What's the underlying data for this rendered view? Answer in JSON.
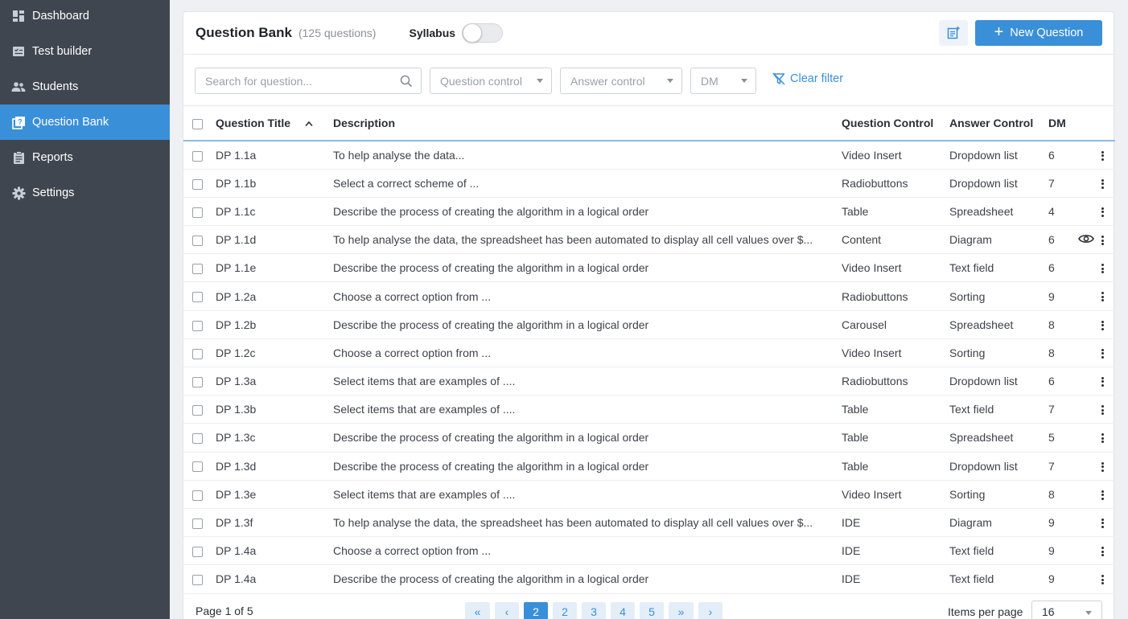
{
  "sidebar": {
    "items": [
      {
        "label": "Dashboard",
        "icon": "dashboard-icon",
        "active": false
      },
      {
        "label": "Test builder",
        "icon": "test-builder-icon",
        "active": false
      },
      {
        "label": "Students",
        "icon": "students-icon",
        "active": false
      },
      {
        "label": "Question Bank",
        "icon": "question-bank-icon",
        "active": true
      },
      {
        "label": "Reports",
        "icon": "reports-icon",
        "active": false
      },
      {
        "label": "Settings",
        "icon": "gear-icon",
        "active": false
      }
    ]
  },
  "header": {
    "title": "Question Bank",
    "count": "(125 questions)",
    "syllabus_label": "Syllabus",
    "syllabus_on": false,
    "new_question_label": "New Question"
  },
  "filters": {
    "search_placeholder": "Search for question...",
    "question_control_placeholder": "Question control",
    "answer_control_placeholder": "Answer control",
    "dm_placeholder": "DM",
    "clear_filter_label": "Clear filter"
  },
  "table": {
    "columns": {
      "title": "Question Title",
      "description": "Description",
      "question_control": "Question Control",
      "answer_control": "Answer Control",
      "dm": "DM"
    },
    "rows": [
      {
        "title": "DP 1.1a",
        "description": "To help analyse the data...",
        "qc": "Video Insert",
        "ac": "Dropdown list",
        "dm": "6",
        "eye": false
      },
      {
        "title": "DP 1.1b",
        "description": "Select a correct scheme of ...",
        "qc": "Radiobuttons",
        "ac": "Dropdown list",
        "dm": "7",
        "eye": false
      },
      {
        "title": "DP 1.1c",
        "description": "Describe the process of creating the algorithm in a logical order",
        "qc": "Table",
        "ac": "Spreadsheet",
        "dm": "4",
        "eye": false
      },
      {
        "title": "DP 1.1d",
        "description": "To help analyse the data, the spreadsheet has been automated to display all cell values over $...",
        "qc": "Content",
        "ac": "Diagram",
        "dm": "6",
        "eye": true
      },
      {
        "title": "DP 1.1e",
        "description": "Describe the process of creating the algorithm in a logical order",
        "qc": "Video Insert",
        "ac": "Text field",
        "dm": "6",
        "eye": false
      },
      {
        "title": "DP 1.2a",
        "description": "Choose a correct option from ...",
        "qc": "Radiobuttons",
        "ac": "Sorting",
        "dm": "9",
        "eye": false
      },
      {
        "title": "DP 1.2b",
        "description": "Describe the process of creating the algorithm in a logical order",
        "qc": "Carousel",
        "ac": "Spreadsheet",
        "dm": "8",
        "eye": false
      },
      {
        "title": "DP 1.2c",
        "description": "Choose a correct option from ...",
        "qc": "Video Insert",
        "ac": "Sorting",
        "dm": "8",
        "eye": false
      },
      {
        "title": "DP 1.3a",
        "description": "Select items that are examples of ....",
        "qc": "Radiobuttons",
        "ac": "Dropdown list",
        "dm": "6",
        "eye": false
      },
      {
        "title": "DP 1.3b",
        "description": "Select items that are examples of ....",
        "qc": "Table",
        "ac": "Text field",
        "dm": "7",
        "eye": false
      },
      {
        "title": "DP 1.3c",
        "description": "Describe the process of creating the algorithm in a logical order",
        "qc": "Table",
        "ac": "Spreadsheet",
        "dm": "5",
        "eye": false
      },
      {
        "title": "DP 1.3d",
        "description": "Describe the process of creating the algorithm in a logical order",
        "qc": "Table",
        "ac": "Dropdown list",
        "dm": "7",
        "eye": false
      },
      {
        "title": "DP 1.3e",
        "description": "Select items that are examples of ....",
        "qc": "Video Insert",
        "ac": "Sorting",
        "dm": "8",
        "eye": false
      },
      {
        "title": "DP 1.3f",
        "description": "To help analyse the data, the spreadsheet has been automated to display all cell values over $...",
        "qc": "IDE",
        "ac": "Diagram",
        "dm": "9",
        "eye": false
      },
      {
        "title": "DP 1.4a",
        "description": "Choose a correct option from ...",
        "qc": "IDE",
        "ac": "Text field",
        "dm": "9",
        "eye": false
      },
      {
        "title": "DP 1.4a",
        "description": "Describe the process of creating the algorithm in a logical order",
        "qc": "IDE",
        "ac": "Text field",
        "dm": "9",
        "eye": false
      }
    ]
  },
  "footer": {
    "page_info": "Page 1 of 5",
    "first_label": "«",
    "prev_label": "‹",
    "pages": [
      "2",
      "2",
      "3",
      "4",
      "5"
    ],
    "active_page_index": 0,
    "next_fast_label": "»",
    "next_label": "›",
    "items_per_page_label": "Items per page",
    "items_per_page_value": "16"
  },
  "colors": {
    "accent": "#3a8fd9",
    "sidebar_bg": "#40464f"
  }
}
